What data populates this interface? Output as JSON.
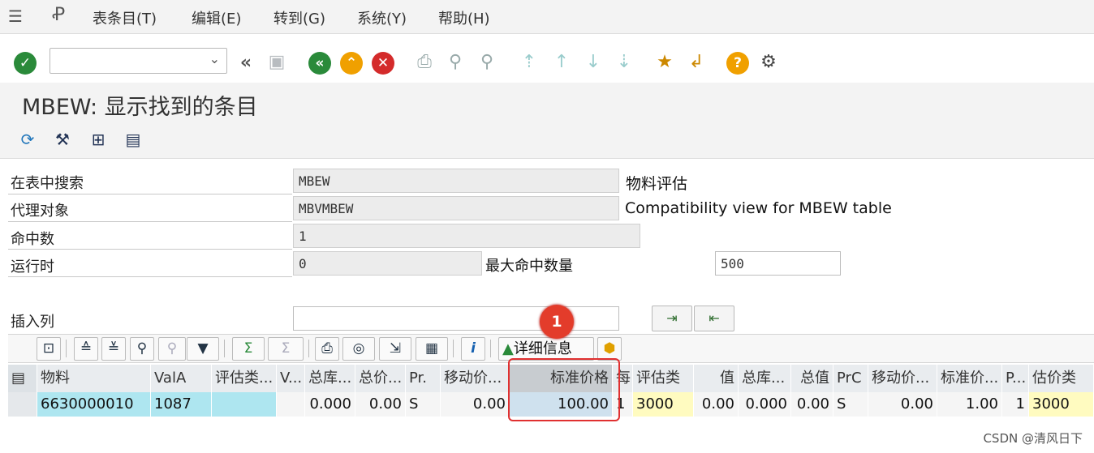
{
  "menu": {
    "items": [
      "表条目(T)",
      "编辑(E)",
      "转到(G)",
      "系统(Y)",
      "帮助(H)"
    ]
  },
  "toolbar": {
    "command_value": "",
    "icons": [
      "enter-icon",
      "back-icon",
      "save-icon",
      "back-green-icon",
      "exit-icon",
      "cancel-icon",
      "print-icon",
      "find-icon",
      "find-next-icon",
      "first-page-icon",
      "prev-page-icon",
      "next-page-icon",
      "last-page-icon",
      "create-session-icon",
      "shortcut-icon",
      "help-icon",
      "settings-icon"
    ]
  },
  "title": "MBEW: 显示找到的条目",
  "app_toolbar": {
    "icons": [
      "refresh-icon",
      "settings-tool-icon",
      "check-table-icon",
      "sql-icon"
    ]
  },
  "form": {
    "table_label": "在表中搜索",
    "table_value": "MBEW",
    "table_desc": "物料评估",
    "proxy_label": "代理对象",
    "proxy_value": "MBVMBEW",
    "proxy_desc": "Compatibility view for MBEW table",
    "hits_label": "命中数",
    "hits_value": "1",
    "runtime_label": "运行时",
    "runtime_value": "0",
    "max_hits_label": "最大命中数量",
    "max_hits_value": "500",
    "insert_col_label": "插入列",
    "insert_col_value": ""
  },
  "alv_toolbar": {
    "details_label": "详细信息"
  },
  "annotation": {
    "badge": "1"
  },
  "grid": {
    "headers": [
      "物料",
      "ValA",
      "评估类...",
      "V...",
      "总库...",
      "总价...",
      "Pr.",
      "移动价...",
      "标准价格",
      "每",
      "评估类",
      "值",
      "总库...",
      "总值",
      "PrC",
      "移动价...",
      "标准价...",
      "P...",
      "估价类"
    ],
    "row": [
      "6630000010",
      "1087",
      "",
      "",
      "0.000",
      "0.00",
      "S",
      "0.00",
      "100.00",
      "1",
      "3000",
      "0.00",
      "0.000",
      "0.00",
      "S",
      "0.00",
      "1.00",
      "1",
      "3000"
    ]
  },
  "colors": {
    "accent_green": "#2a8a3a",
    "exit_orange": "#f0a000",
    "cancel_red": "#d42b2b",
    "highlight_red": "#e03030",
    "key_cyan": "#aee6f0",
    "yellow_cell": "#fffbc0",
    "selected_blue": "#cfe1ee"
  },
  "watermark": "CSDN @清风日下"
}
